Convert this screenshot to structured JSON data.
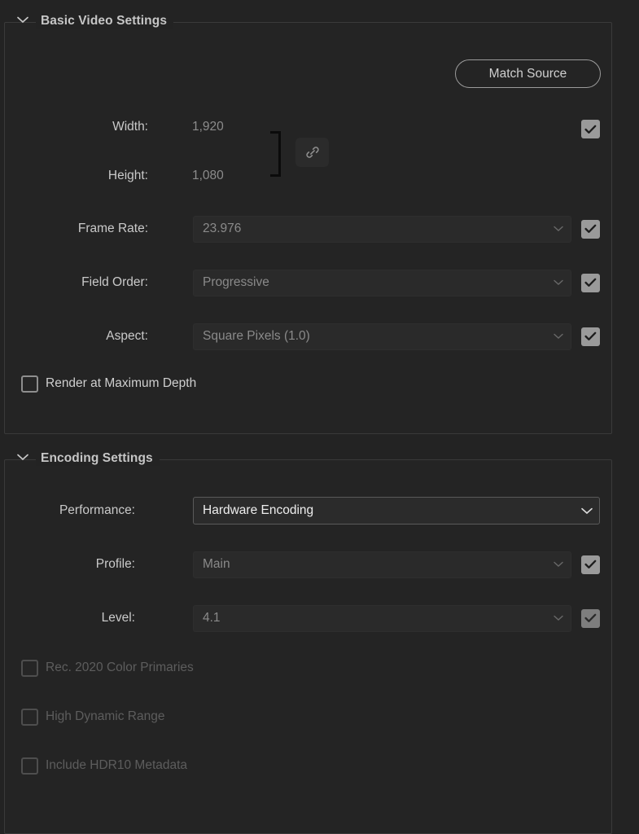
{
  "sections": {
    "basic": {
      "title": "Basic Video Settings",
      "chevron_icon": "chevron-down-icon",
      "match_source_label": "Match Source",
      "link_icon": "link-icon",
      "fields": [
        {
          "label": "Width:",
          "value": "1,920"
        },
        {
          "label": "Height:",
          "value": "1,080"
        },
        {
          "label": "Frame Rate:",
          "value": "23.976"
        },
        {
          "label": "Field Order:",
          "value": "Progressive"
        },
        {
          "label": "Aspect:",
          "value": "Square Pixels (1.0)"
        }
      ],
      "checkbox": {
        "label": "Render at Maximum Depth",
        "checked": false
      }
    },
    "encoding": {
      "title": "Encoding Settings",
      "chevron_icon": "chevron-down-icon",
      "fields": [
        {
          "label": "Performance:",
          "value": "Hardware Encoding"
        },
        {
          "label": "Profile:",
          "value": "Main"
        },
        {
          "label": "Level:",
          "value": "4.1"
        }
      ],
      "checkboxes": [
        {
          "label": "Rec. 2020 Color Primaries",
          "checked": false
        },
        {
          "label": "High Dynamic Range",
          "checked": false
        },
        {
          "label": "Include HDR10 Metadata",
          "checked": false
        }
      ]
    }
  },
  "colors": {
    "background": "#232323",
    "panel": "#242424",
    "border": "#3a3a3a",
    "label": "#cacaca",
    "value_disabled": "#8a8a8a",
    "value_active": "#eeeeee",
    "checkbox_checked": "#9a9a9a",
    "checkbox_disabled": "#5d5d5d"
  }
}
